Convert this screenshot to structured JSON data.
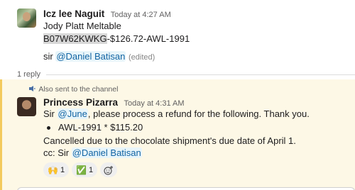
{
  "message1": {
    "sender": "Icz lee Naguit",
    "timestamp": "Today at 4:27 AM",
    "line1": "Jody Platt Meltable",
    "sku_highlight": "B07W62KWKG",
    "sku_rest": "-$126.72-AWL-1991",
    "line3_prefix": "sir ",
    "line3_mention": "@Daniel Batisan",
    "edited": "(edited)"
  },
  "thread": {
    "reply_count": "1 reply",
    "also_sent": "Also sent to the channel"
  },
  "message2": {
    "sender": "Princess Pizarra",
    "timestamp": "Today at 4:31 AM",
    "line1_prefix": "Sir ",
    "line1_mention": "@June",
    "line1_suffix": ", please process a refund for the following. Thank you.",
    "bullet": "AWL-1991 * $115.20",
    "line3": "Cancelled due to the chocolate shipment's due date of April 1.",
    "line4_prefix": "cc: Sir ",
    "line4_mention": "@Daniel Batisan"
  },
  "reactions": [
    {
      "emoji": "🙌",
      "count": "1"
    },
    {
      "emoji": "✅",
      "count": "1"
    }
  ],
  "colors": {
    "mention": "#1264a3",
    "thread_bg": "#fdf8e6",
    "thread_border": "#f3ca5d"
  }
}
